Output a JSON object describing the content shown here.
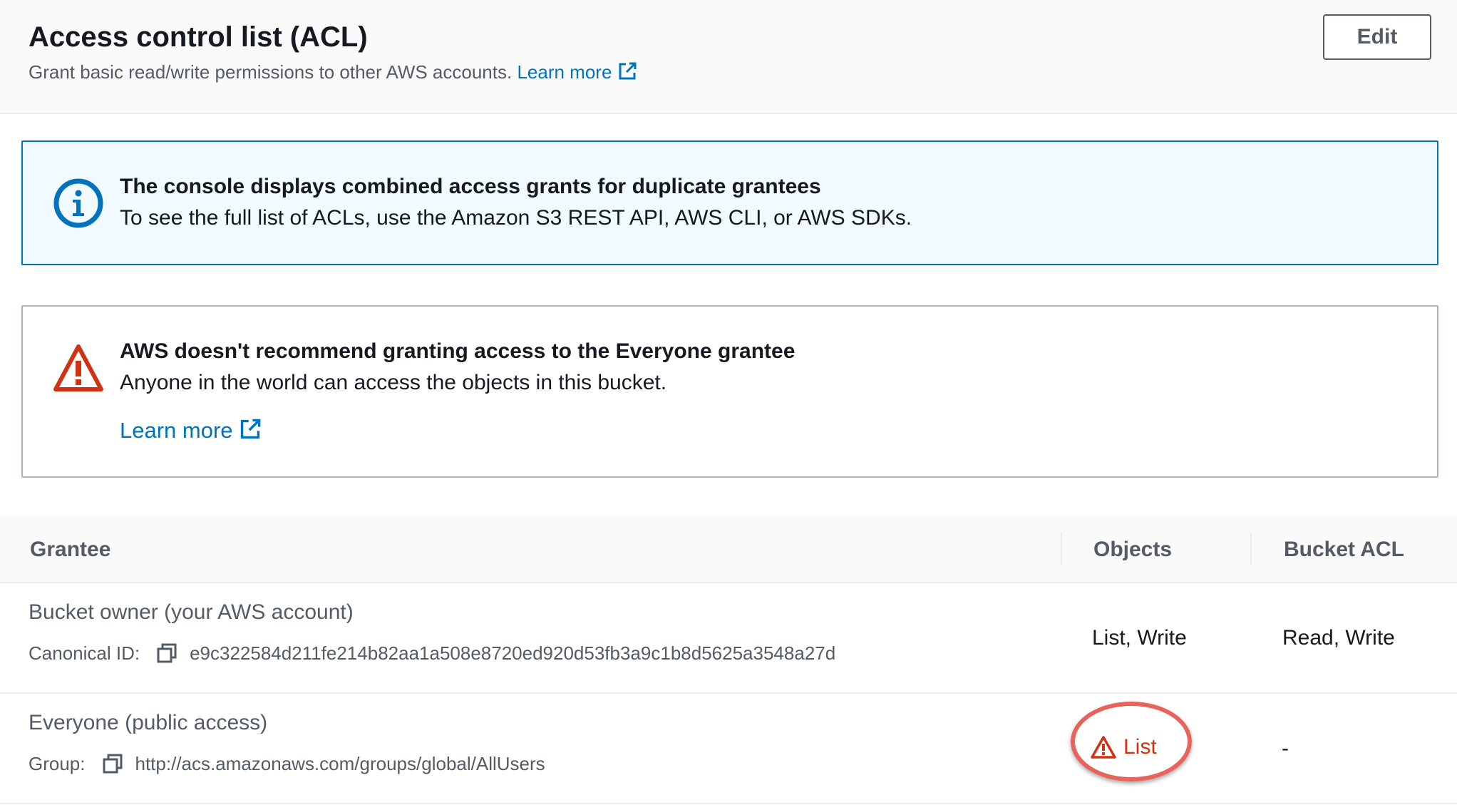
{
  "header": {
    "title": "Access control list (ACL)",
    "description": "Grant basic read/write permissions to other AWS accounts.",
    "learn_more": "Learn more",
    "edit_label": "Edit"
  },
  "info_alert": {
    "title": "The console displays combined access grants for duplicate grantees",
    "body": "To see the full list of ACLs, use the Amazon S3 REST API, AWS CLI, or AWS SDKs.",
    "icon": "info-icon"
  },
  "warning_alert": {
    "title": "AWS doesn't recommend granting access to the Everyone grantee",
    "body": "Anyone in the world can access the objects in this bucket.",
    "learn_more": "Learn more",
    "icon": "warning-icon"
  },
  "table": {
    "columns": [
      "Grantee",
      "Objects",
      "Bucket ACL"
    ],
    "rows": [
      {
        "grantee": "Bucket owner (your AWS account)",
        "id_label": "Canonical ID:",
        "id_value": "e9c322584d211fe214b82aa1a508e8720ed920d53fb3a9c1b8d5625a3548a27d",
        "objects": "List, Write",
        "bucket_acl": "Read, Write"
      },
      {
        "grantee": "Everyone (public access)",
        "id_label": "Group:",
        "id_value": "http://acs.amazonaws.com/groups/global/AllUsers",
        "objects": "List",
        "bucket_acl": "-"
      }
    ]
  },
  "colors": {
    "link": "#0073bb",
    "info_border": "#0073bb",
    "info_bg": "#f1faff",
    "warning": "#d13212",
    "highlight": "#e8645a"
  }
}
